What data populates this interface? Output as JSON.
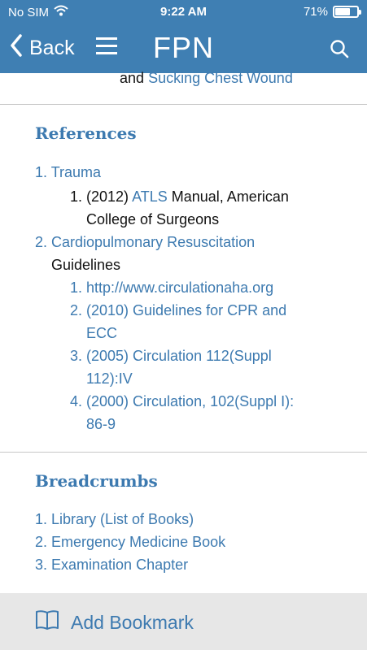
{
  "status_bar": {
    "carrier": "No SIM",
    "time": "9:22 AM",
    "battery_percent": "71%",
    "battery_level": 0.71
  },
  "nav": {
    "back_label": "Back",
    "title": "FPN"
  },
  "content": {
    "previous_text_prefix": "and",
    "previous_text_link": "Sucking Chest Wound",
    "references": {
      "heading": "References",
      "item1_label": "1. Trauma",
      "item1_sub1_number": "1. (2012)",
      "item1_sub1_link": "ATLS",
      "item1_sub1_rest": "Manual, American",
      "item1_sub1_cont": "College of Surgeons",
      "item2_label": "2. Cardiopulmonary Resuscitation",
      "item2_label_cont": "Guidelines",
      "item2_sub1": "1. http://www.circulationaha.org",
      "item2_sub2": "2. (2010) Guidelines for CPR and",
      "item2_sub2_cont": "ECC",
      "item2_sub3": "3. (2005) Circulation 112(Suppl",
      "item2_sub3_cont": "112):IV",
      "item2_sub4": "4. (2000) Circulation, 102(Suppl I):",
      "item2_sub4_cont": "86-9"
    },
    "breadcrumbs": {
      "heading": "Breadcrumbs",
      "items": [
        "1. Library (List of Books)",
        "2. Emergency Medicine Book",
        "3. Examination Chapter"
      ]
    }
  },
  "footer": {
    "bookmark_label": "Add Bookmark"
  },
  "colors": {
    "nav_bg": "#3f7fb3",
    "link": "#3d7ab0",
    "footer_bg": "#e7e7e7"
  }
}
